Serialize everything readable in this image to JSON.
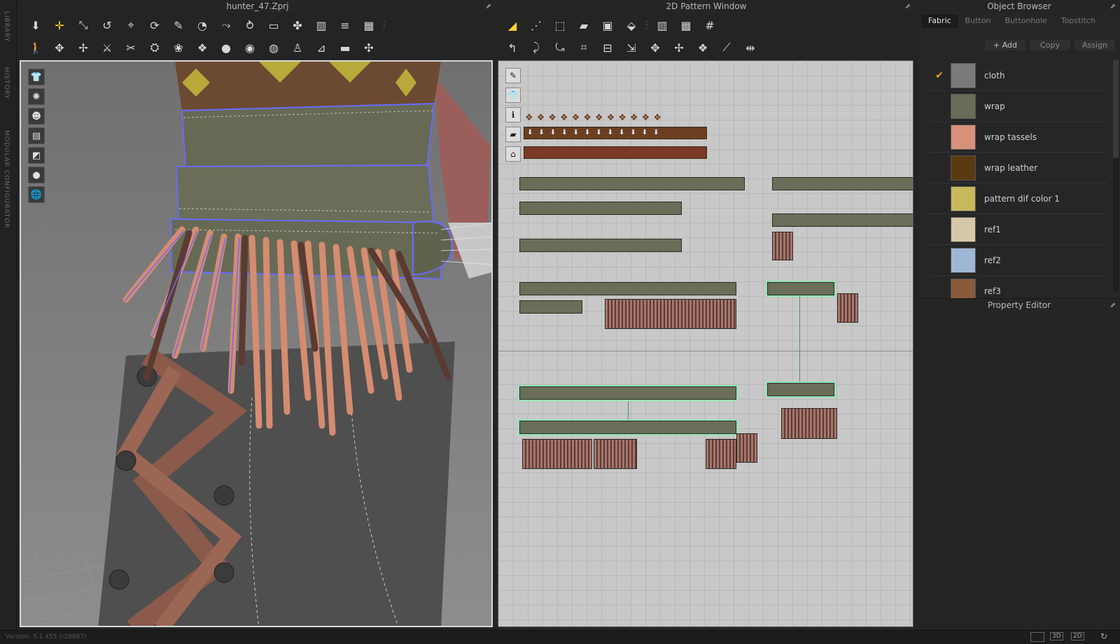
{
  "side_tabs": [
    "LIBRARY",
    "HISTORY",
    "MODULAR CONFIGURATOR"
  ],
  "viewport3d": {
    "title": "hunter_47.Zprj"
  },
  "pattern2d": {
    "title": "2D Pattern Window"
  },
  "object_browser": {
    "title": "Object Browser",
    "tabs": [
      "Fabric",
      "Button",
      "Buttonhole",
      "Topstitch"
    ],
    "actions": {
      "add": "+ Add",
      "copy": "Copy",
      "assign": "Assign"
    },
    "fabrics": [
      {
        "name": "cloth",
        "color": "#7a7a7a",
        "checked": true
      },
      {
        "name": "wrap",
        "color": "#686c58",
        "checked": false
      },
      {
        "name": "wrap tassels",
        "color": "#d8917b",
        "checked": false
      },
      {
        "name": "wrap leather",
        "color": "#5a3a10",
        "checked": false
      },
      {
        "name": "pattern dif color 1",
        "color": "#c8b85c",
        "checked": false
      },
      {
        "name": "ref1",
        "color": "#d6c7a8",
        "checked": false
      },
      {
        "name": "ref2",
        "color": "#9fb7d6",
        "checked": false
      },
      {
        "name": "ref3",
        "color": "#8a5a3a",
        "checked": false
      }
    ]
  },
  "property_editor": {
    "title": "Property Editor"
  },
  "status": {
    "version": "Version: 5.1.455 (r28687)",
    "views": [
      "3D",
      "2D"
    ]
  }
}
